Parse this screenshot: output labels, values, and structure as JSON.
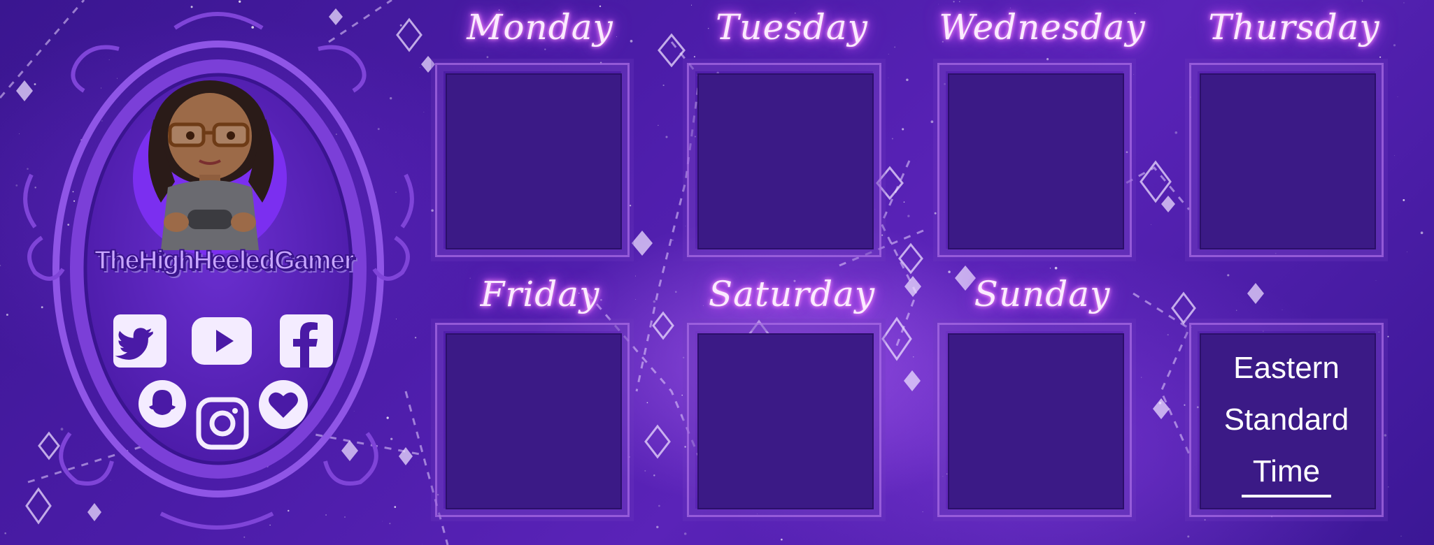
{
  "branding": {
    "channel_name": "TheHighHeeledGamer",
    "avatar": "cartoon-gamer-woman-with-glasses-and-controller"
  },
  "social_icons": [
    {
      "name": "twitter-icon"
    },
    {
      "name": "youtube-icon"
    },
    {
      "name": "facebook-icon"
    },
    {
      "name": "snapchat-icon"
    },
    {
      "name": "instagram-icon"
    },
    {
      "name": "heart-icon"
    }
  ],
  "schedule": {
    "days": [
      {
        "label": "Monday",
        "content": ""
      },
      {
        "label": "Tuesday",
        "content": ""
      },
      {
        "label": "Wednesday",
        "content": ""
      },
      {
        "label": "Thursday",
        "content": ""
      },
      {
        "label": "Friday",
        "content": ""
      },
      {
        "label": "Saturday",
        "content": ""
      },
      {
        "label": "Sunday",
        "content": ""
      }
    ],
    "timezone": {
      "line1": "Eastern",
      "line2": "Standard",
      "line3": "Time"
    }
  },
  "colors": {
    "background": "#4b1ca8",
    "slot": "#3b1a86",
    "neon_text": "#fbeaff",
    "glow": "#e05cff",
    "mirror_frame": "#8a4fe0",
    "icon_fill": "#f4ecff"
  }
}
